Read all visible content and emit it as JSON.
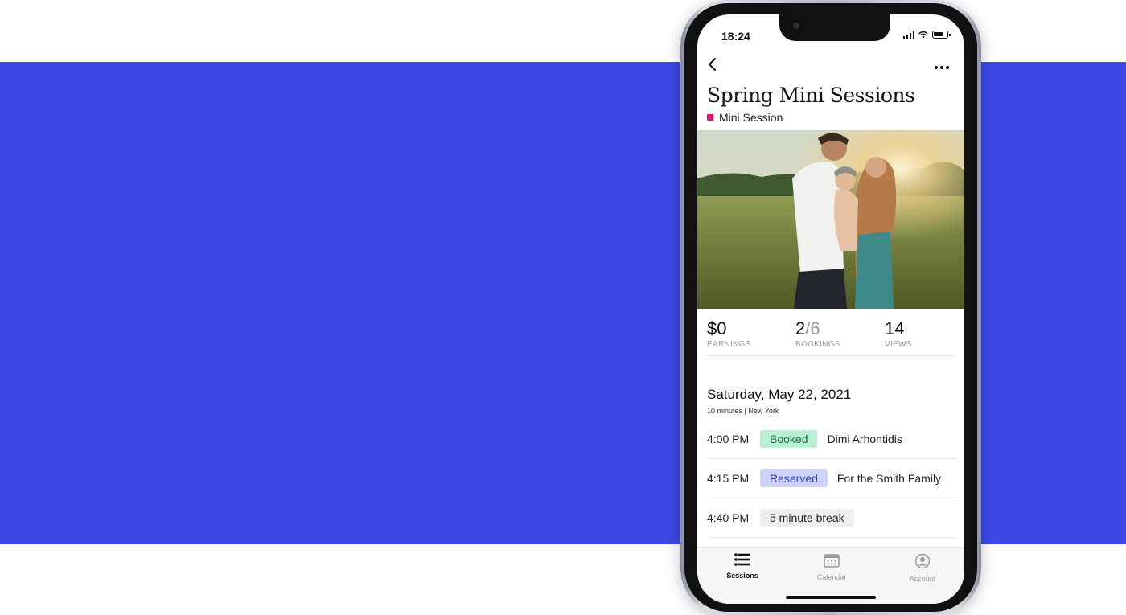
{
  "status_bar": {
    "time": "18:24"
  },
  "nav": {
    "back_icon": "chevron-left-icon",
    "more_icon": "ellipsis-icon"
  },
  "session": {
    "title": "Spring Mini Sessions",
    "type_label": "Mini Session",
    "type_color": "#e0107a"
  },
  "stats": {
    "earnings": {
      "value": "$0",
      "label": "EARNINGS"
    },
    "bookings": {
      "value": "2",
      "total": "/6",
      "label": "BOOKINGS"
    },
    "views": {
      "value": "14",
      "label": "VIEWS"
    }
  },
  "schedule": {
    "date": "Saturday, May 22, 2021",
    "details": "10 minutes | New York",
    "slots": [
      {
        "time": "4:00 PM",
        "status": "Booked",
        "status_bg": "#b9f0d4",
        "status_fg": "#1f6b45",
        "name": "Dimi Arhontidis"
      },
      {
        "time": "4:15 PM",
        "status": "Reserved",
        "status_bg": "#cdd3fb",
        "status_fg": "#3440b8",
        "name": "For the Smith Family"
      },
      {
        "time": "4:40 PM",
        "status": "5 minute break",
        "status_bg": "#efefef",
        "status_fg": "#222222",
        "name": ""
      }
    ]
  },
  "tabbar": {
    "tabs": [
      {
        "label": "Sessions",
        "icon": "list-icon",
        "active": true
      },
      {
        "label": "Calendar",
        "icon": "calendar-icon",
        "active": false
      },
      {
        "label": "Account",
        "icon": "account-icon",
        "active": false
      }
    ]
  },
  "colors": {
    "band": "#3d47e5",
    "accent_active": "#111111",
    "inactive": "#9a9a9a"
  }
}
